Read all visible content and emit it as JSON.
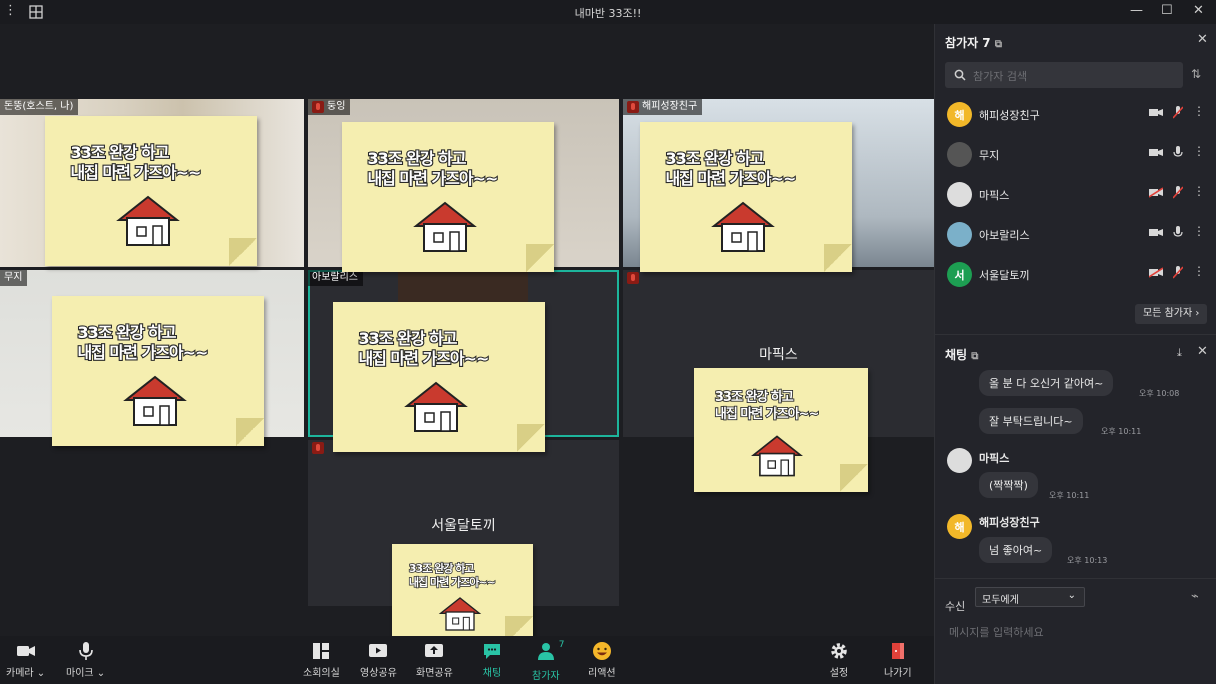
{
  "window": {
    "title": "내마반 33조!!"
  },
  "stage": {
    "tiles": [
      {
        "name": "돈뚱(호스트, 나)"
      },
      {
        "name": "둥잉"
      },
      {
        "name": "해피성장친구"
      },
      {
        "name": "무지"
      },
      {
        "name": "아보랄리스"
      },
      {
        "name": "마픽스"
      },
      {
        "name": "서울달토끼"
      }
    ],
    "sticky_line1": "33조 완강 하고",
    "sticky_line2": "내집 마련 가즈아~~"
  },
  "toolbar": {
    "camera": "카메라",
    "mic": "마이크",
    "breakout": "소회의실",
    "video_share": "영상공유",
    "screen_share": "화면공유",
    "chat": "채팅",
    "participants": "참가자",
    "participants_count": "7",
    "reaction": "리액션",
    "settings": "설정",
    "leave": "나가기"
  },
  "participants_panel": {
    "title": "참가자 7",
    "search_placeholder": "참가자 검색",
    "all_button": "모든 참가자",
    "list": [
      {
        "name": "해피성장친구",
        "initial": "해",
        "color": "#f2b829"
      },
      {
        "name": "무지",
        "initial": "",
        "color": "#555"
      },
      {
        "name": "마픽스",
        "initial": "",
        "color": "#ddd"
      },
      {
        "name": "아보랄리스",
        "initial": "",
        "color": "#7bb0c9"
      },
      {
        "name": "서울달토끼",
        "initial": "서",
        "color": "#1d9e52"
      }
    ]
  },
  "chat_panel": {
    "title": "채팅",
    "messages": [
      {
        "text": "올 분 다 오신거 같아여~",
        "time": "오후 10:08"
      },
      {
        "text": "잘 부탁드립니다~",
        "time": "오후 10:11"
      },
      {
        "sender": "마픽스",
        "text": "(짝짝짝)",
        "time": "오후 10:11"
      },
      {
        "sender": "해피성장친구",
        "text": "넘 좋아여~",
        "time": "오후 10:13"
      }
    ],
    "recipient_label": "수신",
    "recipient_value": "모두에게",
    "input_placeholder": "메시지를 입력하세요"
  }
}
